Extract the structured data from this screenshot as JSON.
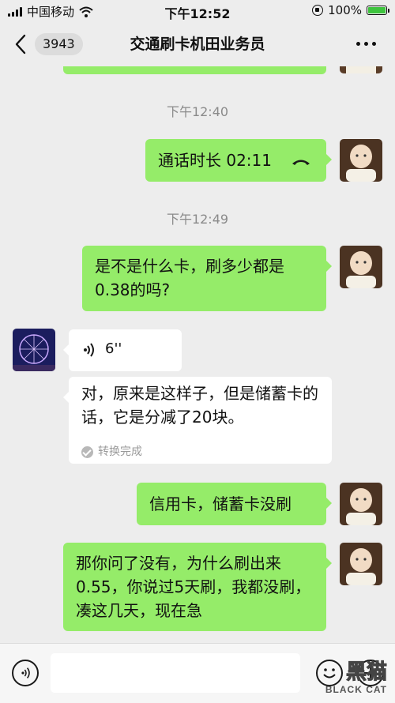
{
  "status_bar": {
    "carrier": "中国移动",
    "time": "下午12:52",
    "battery_percent": "100%"
  },
  "nav": {
    "unread_count": "3943",
    "title": "交通刷卡机田业务员"
  },
  "messages": {
    "timestamp_1": "下午12:40",
    "call": {
      "text": "通话时长 02:11"
    },
    "timestamp_2": "下午12:49",
    "msg1": "是不是什么卡，刷多少都是0.38的吗?",
    "voice": {
      "duration": "6''"
    },
    "transcript": {
      "text": "对，原来是这样子，但是储蓄卡的话，它是分减了20块。",
      "status": "转换完成"
    },
    "msg2": "信用卡，储蓄卡没刷",
    "msg3": "那你问了没有，为什么刷出来0.55，你说过5天刷，我都没刷，凑这几天，现在急"
  },
  "watermark": {
    "text": "黑猫",
    "sub": "BLACK CAT"
  },
  "colors": {
    "outgoing_bubble": "#95ec69",
    "incoming_bubble": "#ffffff",
    "background": "#ededed"
  }
}
